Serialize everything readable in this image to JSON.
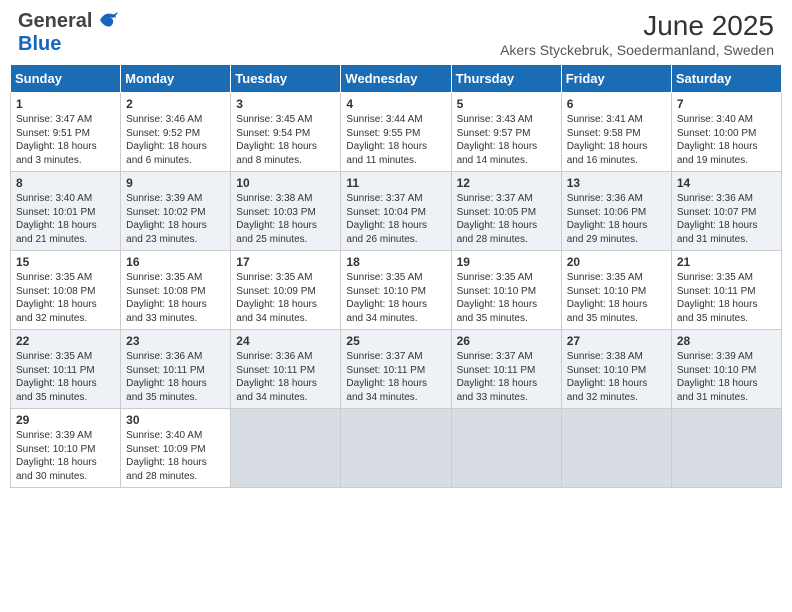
{
  "header": {
    "logo_general": "General",
    "logo_blue": "Blue",
    "title": "June 2025",
    "subtitle": "Akers Styckebruk, Soedermanland, Sweden"
  },
  "days_of_week": [
    "Sunday",
    "Monday",
    "Tuesday",
    "Wednesday",
    "Thursday",
    "Friday",
    "Saturday"
  ],
  "weeks": [
    {
      "cells": [
        {
          "day": "1",
          "sunrise": "3:47 AM",
          "sunset": "9:51 PM",
          "daylight": "18 hours and 3 minutes."
        },
        {
          "day": "2",
          "sunrise": "3:46 AM",
          "sunset": "9:52 PM",
          "daylight": "18 hours and 6 minutes."
        },
        {
          "day": "3",
          "sunrise": "3:45 AM",
          "sunset": "9:54 PM",
          "daylight": "18 hours and 8 minutes."
        },
        {
          "day": "4",
          "sunrise": "3:44 AM",
          "sunset": "9:55 PM",
          "daylight": "18 hours and 11 minutes."
        },
        {
          "day": "5",
          "sunrise": "3:43 AM",
          "sunset": "9:57 PM",
          "daylight": "18 hours and 14 minutes."
        },
        {
          "day": "6",
          "sunrise": "3:41 AM",
          "sunset": "9:58 PM",
          "daylight": "18 hours and 16 minutes."
        },
        {
          "day": "7",
          "sunrise": "3:40 AM",
          "sunset": "10:00 PM",
          "daylight": "18 hours and 19 minutes."
        }
      ]
    },
    {
      "cells": [
        {
          "day": "8",
          "sunrise": "3:40 AM",
          "sunset": "10:01 PM",
          "daylight": "18 hours and 21 minutes."
        },
        {
          "day": "9",
          "sunrise": "3:39 AM",
          "sunset": "10:02 PM",
          "daylight": "18 hours and 23 minutes."
        },
        {
          "day": "10",
          "sunrise": "3:38 AM",
          "sunset": "10:03 PM",
          "daylight": "18 hours and 25 minutes."
        },
        {
          "day": "11",
          "sunrise": "3:37 AM",
          "sunset": "10:04 PM",
          "daylight": "18 hours and 26 minutes."
        },
        {
          "day": "12",
          "sunrise": "3:37 AM",
          "sunset": "10:05 PM",
          "daylight": "18 hours and 28 minutes."
        },
        {
          "day": "13",
          "sunrise": "3:36 AM",
          "sunset": "10:06 PM",
          "daylight": "18 hours and 29 minutes."
        },
        {
          "day": "14",
          "sunrise": "3:36 AM",
          "sunset": "10:07 PM",
          "daylight": "18 hours and 31 minutes."
        }
      ]
    },
    {
      "cells": [
        {
          "day": "15",
          "sunrise": "3:35 AM",
          "sunset": "10:08 PM",
          "daylight": "18 hours and 32 minutes."
        },
        {
          "day": "16",
          "sunrise": "3:35 AM",
          "sunset": "10:08 PM",
          "daylight": "18 hours and 33 minutes."
        },
        {
          "day": "17",
          "sunrise": "3:35 AM",
          "sunset": "10:09 PM",
          "daylight": "18 hours and 34 minutes."
        },
        {
          "day": "18",
          "sunrise": "3:35 AM",
          "sunset": "10:10 PM",
          "daylight": "18 hours and 34 minutes."
        },
        {
          "day": "19",
          "sunrise": "3:35 AM",
          "sunset": "10:10 PM",
          "daylight": "18 hours and 35 minutes."
        },
        {
          "day": "20",
          "sunrise": "3:35 AM",
          "sunset": "10:10 PM",
          "daylight": "18 hours and 35 minutes."
        },
        {
          "day": "21",
          "sunrise": "3:35 AM",
          "sunset": "10:11 PM",
          "daylight": "18 hours and 35 minutes."
        }
      ]
    },
    {
      "cells": [
        {
          "day": "22",
          "sunrise": "3:35 AM",
          "sunset": "10:11 PM",
          "daylight": "18 hours and 35 minutes."
        },
        {
          "day": "23",
          "sunrise": "3:36 AM",
          "sunset": "10:11 PM",
          "daylight": "18 hours and 35 minutes."
        },
        {
          "day": "24",
          "sunrise": "3:36 AM",
          "sunset": "10:11 PM",
          "daylight": "18 hours and 34 minutes."
        },
        {
          "day": "25",
          "sunrise": "3:37 AM",
          "sunset": "10:11 PM",
          "daylight": "18 hours and 34 minutes."
        },
        {
          "day": "26",
          "sunrise": "3:37 AM",
          "sunset": "10:11 PM",
          "daylight": "18 hours and 33 minutes."
        },
        {
          "day": "27",
          "sunrise": "3:38 AM",
          "sunset": "10:10 PM",
          "daylight": "18 hours and 32 minutes."
        },
        {
          "day": "28",
          "sunrise": "3:39 AM",
          "sunset": "10:10 PM",
          "daylight": "18 hours and 31 minutes."
        }
      ]
    },
    {
      "cells": [
        {
          "day": "29",
          "sunrise": "3:39 AM",
          "sunset": "10:10 PM",
          "daylight": "18 hours and 30 minutes."
        },
        {
          "day": "30",
          "sunrise": "3:40 AM",
          "sunset": "10:09 PM",
          "daylight": "18 hours and 28 minutes."
        },
        null,
        null,
        null,
        null,
        null
      ]
    }
  ]
}
